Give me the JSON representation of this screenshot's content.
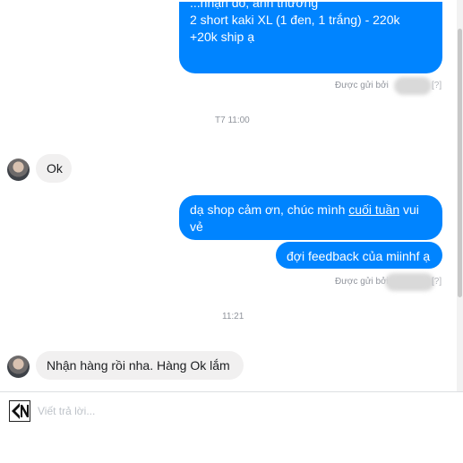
{
  "messages": [
    {
      "cut_line": "...nhận đồ, anh thương",
      "line1": "2 short kaki XL (1 đen, 1 trắng) - 220k",
      "line2": "+20k ship ạ"
    }
  ],
  "sent_by_label": "Được gửi bởi",
  "question_mark": "[?]",
  "time_1": "T7 11:00",
  "reply_ok": "Ok",
  "msg_thanks_part1": "dạ shop cảm ơn, chúc mình ",
  "msg_thanks_link": "cuối tuần",
  "msg_thanks_part2": " vui",
  "msg_thanks_line2": "vẻ",
  "msg_feedback": "đợi feedback của miinhf ạ",
  "time_2": "11:21",
  "reply_received": "Nhận hàng rồi nha. Hàng Ok lắm",
  "reply_placeholder": "Viết trả lời..."
}
